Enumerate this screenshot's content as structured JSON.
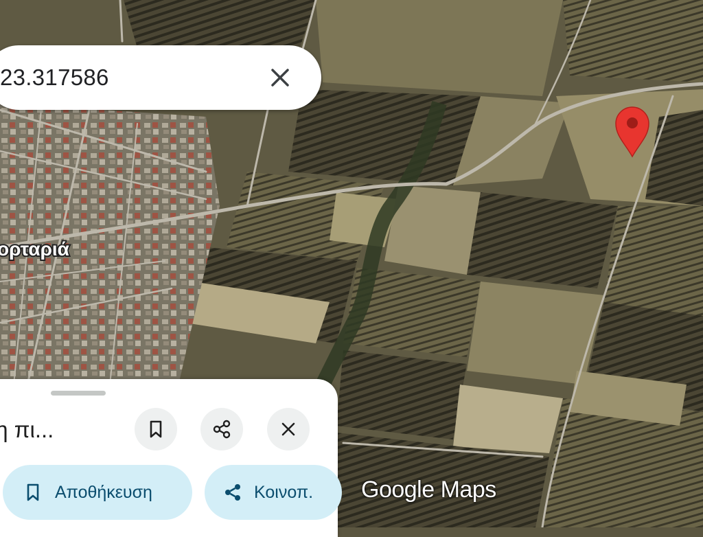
{
  "search": {
    "query": "23.317586"
  },
  "map": {
    "town_label": "ορταριά",
    "watermark": "Google Maps",
    "pin_color": "#e8352f"
  },
  "sheet": {
    "title": "ένη πι...",
    "save_label": "Αποθήκευση",
    "share_label": "Κοινοπ."
  },
  "icons": {
    "clear": "close-icon",
    "bookmark": "bookmark-icon",
    "share": "share-icon",
    "close": "close-icon",
    "pin": "map-pin-icon"
  },
  "colors": {
    "accent_pill": "#d3eef7",
    "accent_text": "#0b4d6e",
    "pin": "#e8352f"
  }
}
